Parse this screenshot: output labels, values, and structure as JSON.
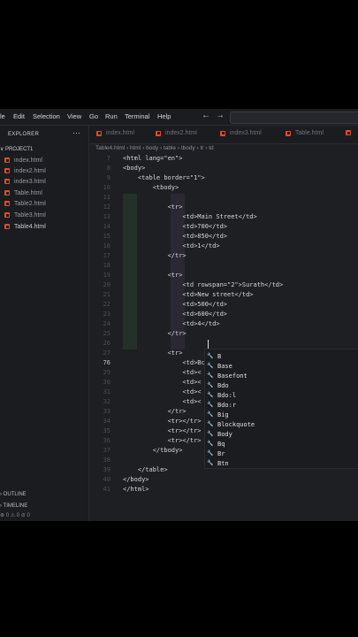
{
  "menu": [
    "le",
    "Edit",
    "Selection",
    "View",
    "Go",
    "Run",
    "Terminal",
    "Help"
  ],
  "sidebar": {
    "title": "EXPLORER",
    "more": "···",
    "project": "∨ PROJECT1",
    "files": [
      "index.html",
      "index2.html",
      "index3.html",
      "Table.html",
      "Table2.html",
      "Table3.html",
      "Table4.html"
    ],
    "outline": "› OUTLINE",
    "timeline": "› TIMELINE",
    "status": "⊗ 0 ⚠ 0   ⊘ 0"
  },
  "tabs": [
    "index.html",
    "index2.html",
    "index3.html",
    "Table.html"
  ],
  "breadcrumb": "Table4.html  ›  html  ›  body  ›  table  ›  tbody  ›  tr  ›  td",
  "lines": [
    {
      "n": "7",
      "c": "<html lang=\"en\">"
    },
    {
      "n": "8",
      "c": "<body>"
    },
    {
      "n": "9",
      "c": "    <table border=\"1\">"
    },
    {
      "n": "10",
      "c": "        <tbody>"
    },
    {
      "n": "11",
      "c": ""
    },
    {
      "n": "12",
      "c": "            <tr>"
    },
    {
      "n": "13",
      "c": "                <td>Main Street</td>"
    },
    {
      "n": "14",
      "c": "                <td>700</td>"
    },
    {
      "n": "15",
      "c": "                <td>850</td>"
    },
    {
      "n": "16",
      "c": "                <td>1</td>"
    },
    {
      "n": "17",
      "c": "            </tr>"
    },
    {
      "n": "18",
      "c": ""
    },
    {
      "n": "19",
      "c": "            <tr>"
    },
    {
      "n": "20",
      "c": "                <td rowspan=\"2\">Surath</td>"
    },
    {
      "n": "21",
      "c": "                <td>New street</td>"
    },
    {
      "n": "22",
      "c": "                <td>500</td>"
    },
    {
      "n": "23",
      "c": "                <td>600</td>"
    },
    {
      "n": "24",
      "c": "                <td>4</td>"
    },
    {
      "n": "25",
      "c": "            </tr>"
    },
    {
      "n": "26",
      "c": ""
    },
    {
      "n": "27",
      "c": "            <tr>"
    },
    {
      "n": "28",
      "c": "                <td>Bc</td>"
    },
    {
      "n": "29",
      "c": "                <td><"
    },
    {
      "n": "30",
      "c": "                <td><"
    },
    {
      "n": "31",
      "c": "                <td><"
    },
    {
      "n": "32",
      "c": "                <td><"
    },
    {
      "n": "33",
      "c": "            </tr>"
    },
    {
      "n": "34",
      "c": "            <tr></tr>"
    },
    {
      "n": "35",
      "c": "            <tr></tr>"
    },
    {
      "n": "36",
      "c": "            <tr></tr>"
    },
    {
      "n": "37",
      "c": "        </tbody>"
    },
    {
      "n": "38",
      "c": ""
    },
    {
      "n": "39",
      "c": "    </table>"
    },
    {
      "n": "40",
      "c": "</body>"
    },
    {
      "n": "41",
      "c": "</html>"
    }
  ],
  "current_line": "76",
  "suggestions": [
    "B",
    "Base",
    "Basefont",
    "Bdo",
    "Bdo:l",
    "Bdo:r",
    "Big",
    "Blockquote",
    "Body",
    "Bq",
    "Br",
    "Btn"
  ]
}
